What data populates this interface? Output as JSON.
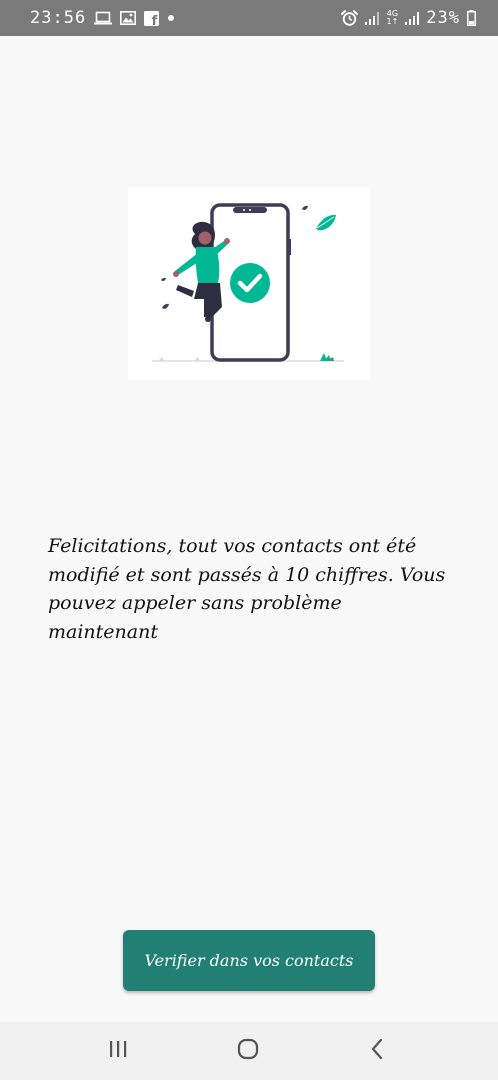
{
  "status_bar": {
    "time": "23:56",
    "battery_percent": "23%",
    "network_label": "4G",
    "network_sub": "1↑",
    "left_icons": [
      "laptop-icon",
      "image-icon",
      "facebook-icon",
      "dot-icon"
    ],
    "right_icons": [
      "alarm-icon",
      "signal-icon",
      "network-4g-icon",
      "signal-icon",
      "battery-icon"
    ],
    "facebook_letter": "f"
  },
  "illustration": {
    "name": "phone-success-illustration",
    "accent_color": "#00b894"
  },
  "message": {
    "text": "Felicitations, tout vos contacts ont été modifié et sont passés à 10 chiffres. Vous pouvez appeler sans problème maintenant"
  },
  "button": {
    "label": "Verifier dans vos contacts",
    "color": "#227f74"
  },
  "nav_bar": {
    "buttons": [
      "recent-apps-icon",
      "home-icon",
      "back-icon"
    ]
  }
}
